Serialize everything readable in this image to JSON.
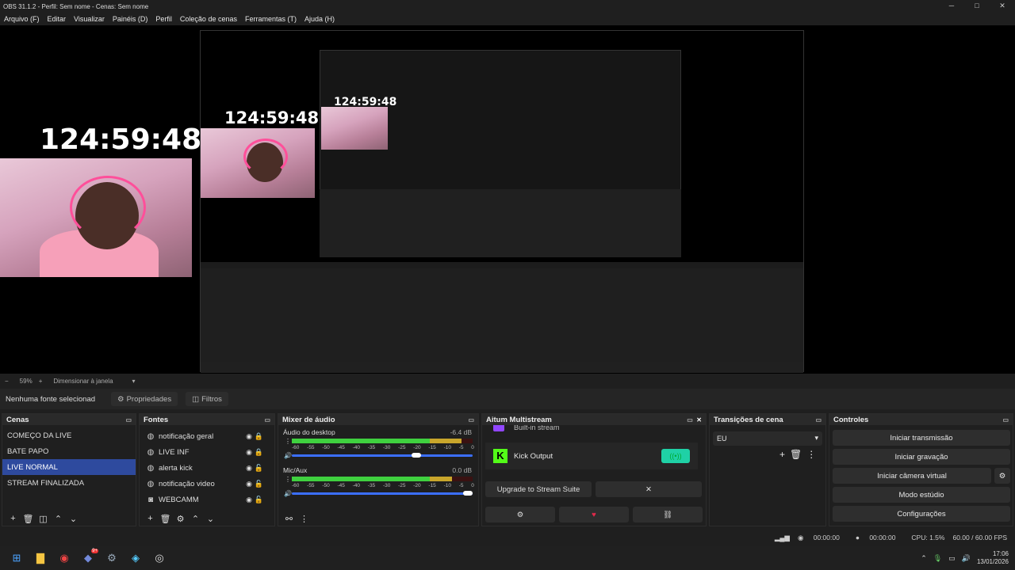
{
  "window": {
    "title": "OBS 31.1.2 - Perfil: Sem nome - Cenas: Sem nome",
    "minimize": "─",
    "maximize": "□",
    "close": "✕"
  },
  "menu": [
    "Arquivo (F)",
    "Editar",
    "Visualizar",
    "Painéis (D)",
    "Perfil",
    "Coleção de cenas",
    "Ferramentas (T)",
    "Ajuda (H)"
  ],
  "preview": {
    "timer": "124:59:48"
  },
  "statusrow": {
    "minus": "−",
    "zoom": "59%",
    "plus": "+",
    "resize": "Dimensionar à janela"
  },
  "props": {
    "no_source": "Nenhuma fonte selecionad",
    "properties": "Propriedades",
    "filters": "Filtros"
  },
  "scenes": {
    "title": "Cenas",
    "items": [
      "COMEÇO DA LIVE",
      "BATE PAPO",
      "LIVE NORMAL",
      "STREAM FINALIZADA"
    ],
    "selected": 2
  },
  "sources": {
    "title": "Fontes",
    "items": [
      {
        "name": "notificação geral",
        "icon": "globe-icon"
      },
      {
        "name": "LIVE INF",
        "icon": "globe-icon"
      },
      {
        "name": "alerta kick",
        "icon": "globe-icon"
      },
      {
        "name": "notificação video",
        "icon": "globe-icon"
      },
      {
        "name": "WEBCAMM",
        "icon": "camera-icon"
      }
    ]
  },
  "mixer": {
    "title": "Mixer de áudio",
    "channels": [
      {
        "name": "Áudio do desktop",
        "db": "-6.4 dB",
        "level": 0.78,
        "volume": 0.7
      },
      {
        "name": "Mic/Aux",
        "db": "0.0 dB",
        "level": 0.85,
        "volume": 1.0
      }
    ],
    "ticks": [
      "-60",
      "-55",
      "-50",
      "-45",
      "-40",
      "-35",
      "-30",
      "-25",
      "-20",
      "-15",
      "-10",
      "-5",
      "0"
    ]
  },
  "multistream": {
    "title": "Aitum Multistream",
    "partial": "Built-in stream",
    "kick": "Kick Output",
    "upgrade": "Upgrade to Stream Suite",
    "close_x": "✕"
  },
  "transitions": {
    "title": "Transições de cena",
    "current": "EU"
  },
  "controls": {
    "title": "Controles",
    "buttons": [
      "Iniciar transmissão",
      "Iniciar gravação",
      "Iniciar câmera virtual",
      "Modo estúdio",
      "Configurações"
    ]
  },
  "obsstatus": {
    "rec_time": "00:00:00",
    "stream_time": "00:00:00",
    "cpu": "CPU: 1.5%",
    "fps": "60.00 / 60.00 FPS"
  },
  "taskbar": {
    "time": "17:06",
    "date": "13/01/2026",
    "badge": "9+"
  },
  "colors": {
    "accent": "#2e4a9e",
    "kick": "#53fc18",
    "teal": "#1fd1a6",
    "record": "#e0294a"
  }
}
